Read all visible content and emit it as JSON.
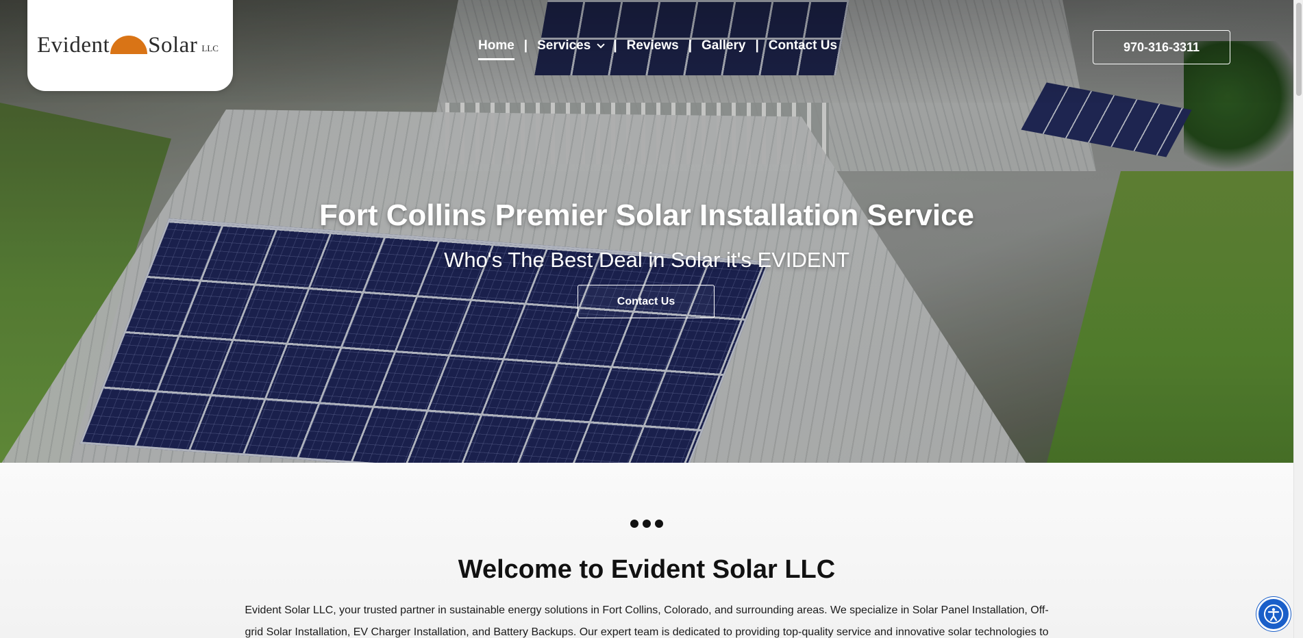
{
  "brand": {
    "logo_word_1": "Evident",
    "logo_word_2": "Solar",
    "logo_suffix": "LLC",
    "sun_color": "#d97416"
  },
  "nav": {
    "items": [
      {
        "label": "Home",
        "active": true
      },
      {
        "label": "Services",
        "has_dropdown": true
      },
      {
        "label": "Reviews"
      },
      {
        "label": "Gallery"
      },
      {
        "label": "Contact Us"
      }
    ],
    "separator": "|"
  },
  "header": {
    "phone": "970-316-3311"
  },
  "hero": {
    "title": "Fort Collins Premier Solar Installation Service",
    "subtitle": "Who's The Best Deal in Solar it's EVIDENT",
    "cta_label": "Contact Us"
  },
  "welcome": {
    "title": "Welcome to Evident Solar LLC",
    "text": "Evident Solar LLC, your trusted partner in sustainable energy solutions in Fort Collins, Colorado, and surrounding areas. We specialize in Solar Panel Installation, Off-grid Solar Installation, EV Charger Installation, and Battery Backups. Our expert team is dedicated to providing top-quality service and innovative solar technologies to power"
  },
  "icons": {
    "accessibility": "accessibility-icon",
    "dropdown": "chevron-down-icon",
    "divider": "dots-divider-icon"
  },
  "colors": {
    "accessibility_button": "#1a5fc9"
  }
}
